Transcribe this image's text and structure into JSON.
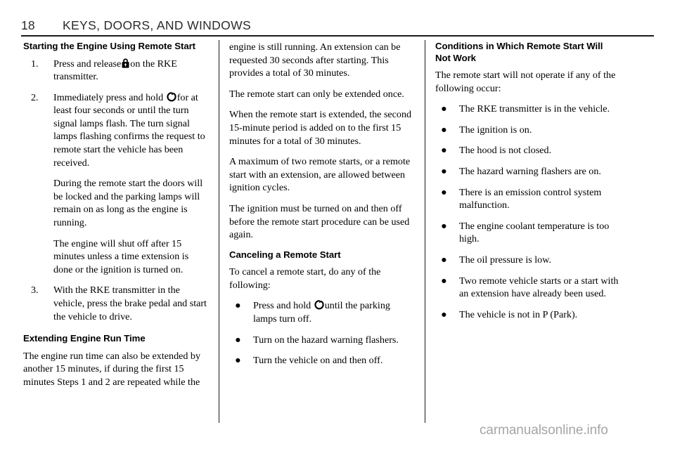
{
  "header": {
    "page_number": "18",
    "chapter_title": "KEYS, DOORS, AND WINDOWS"
  },
  "icons": {
    "lock": "lock-icon",
    "remote_start": "remote-start-icon"
  },
  "column1": {
    "heading": "Starting the Engine Using Remote Start",
    "steps": [
      {
        "number": "1.",
        "text_before": "Press and release",
        "icon": "lock-icon",
        "text_after": "on the RKE transmitter."
      },
      {
        "number": "2.",
        "text_before": "Immediately press and hold",
        "icon": "remote-start-icon",
        "text_after": "for at least four seconds or until the turn signal lamps flash. The turn signal lamps flashing confirms the request to remote start the vehicle has been received.",
        "extra_paragraphs": [
          "During the remote start the doors will be locked and the parking lamps will remain on as long as the engine is running.",
          "The engine will shut off after 15 minutes unless a time extension is done or the ignition is turned on."
        ]
      },
      {
        "number": "3.",
        "text_before": "With the RKE transmitter in the vehicle, press the brake pedal and start the vehicle to drive.",
        "icon": "",
        "text_after": ""
      }
    ],
    "heading2": "Extending Engine Run Time",
    "paragraph1": "The engine run time can also be extended by another 15 minutes, if during the first 15 minutes Steps 1 and 2 are repeated while the"
  },
  "column2": {
    "paragraph1": "engine is still running. An extension can be requested 30 seconds after starting. This provides a total of 30 minutes.",
    "paragraph2": "The remote start can only be extended once.",
    "paragraph3": "When the remote start is extended, the second 15-minute period is added on to the first 15 minutes for a total of 30 minutes.",
    "paragraph4": "A maximum of two remote starts, or a remote start with an extension, are allowed between ignition cycles.",
    "paragraph5": "The ignition must be turned on and then off before the remote start procedure can be used again.",
    "heading": "Canceling a Remote Start",
    "paragraph6": "To cancel a remote start, do any of the following:",
    "bullets": [
      {
        "text_before": "Press and hold",
        "icon": "remote-start-icon",
        "text_after": "until the parking lamps turn off."
      },
      {
        "text_before": "Turn on the hazard warning flashers.",
        "icon": "",
        "text_after": ""
      },
      {
        "text_before": "Turn the vehicle on and then off.",
        "icon": "",
        "text_after": ""
      }
    ],
    "bullet_glyph": "●"
  },
  "column3": {
    "heading": "Conditions in Which Remote Start Will Not Work",
    "paragraph1": "The remote start will not operate if any of the following occur:",
    "bullets": [
      "The RKE transmitter is in the vehicle.",
      "The ignition is on.",
      "The hood is not closed.",
      "The hazard warning flashers are on.",
      "There is an emission control system malfunction.",
      "The engine coolant temperature is too high.",
      "The oil pressure is low.",
      "Two remote vehicle starts or a start with an extension have already been used.",
      "The vehicle is not in P (Park)."
    ],
    "bullet_glyph": "●"
  },
  "watermark": {
    "text": "carmanualsonline.info"
  }
}
